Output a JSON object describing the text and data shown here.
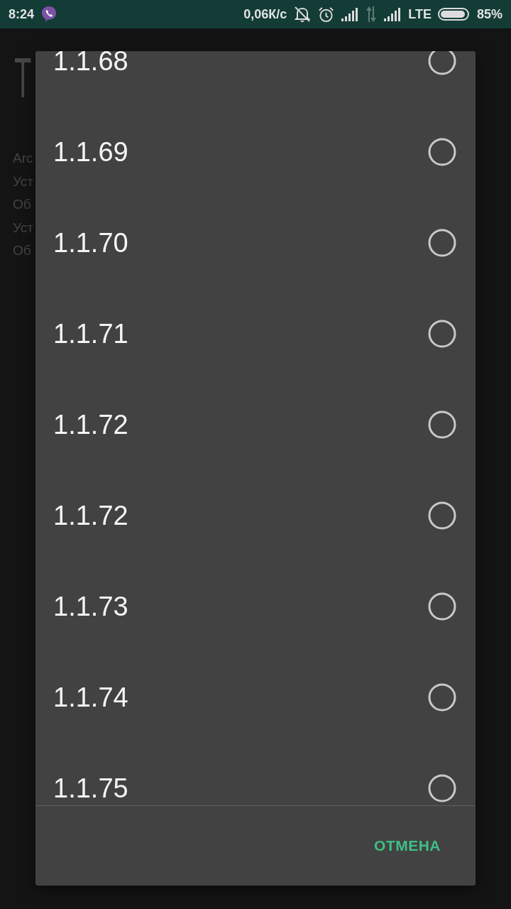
{
  "status_bar": {
    "time": "8:24",
    "network_speed": "0,06К/с",
    "network_type": "LTE",
    "battery": "85%"
  },
  "background_screen": {
    "title": "T",
    "lines": [
      "Arc",
      "Уст",
      "Об",
      "Уст",
      "Об"
    ]
  },
  "dialog": {
    "options": [
      {
        "label": "1.1.68",
        "selected": false
      },
      {
        "label": "1.1.69",
        "selected": false
      },
      {
        "label": "1.1.70",
        "selected": false
      },
      {
        "label": "1.1.71",
        "selected": false
      },
      {
        "label": "1.1.72",
        "selected": false
      },
      {
        "label": "1.1.72",
        "selected": false
      },
      {
        "label": "1.1.73",
        "selected": false
      },
      {
        "label": "1.1.74",
        "selected": false
      },
      {
        "label": "1.1.75",
        "selected": false
      }
    ],
    "buttons": [
      "ОТМЕНА"
    ]
  }
}
